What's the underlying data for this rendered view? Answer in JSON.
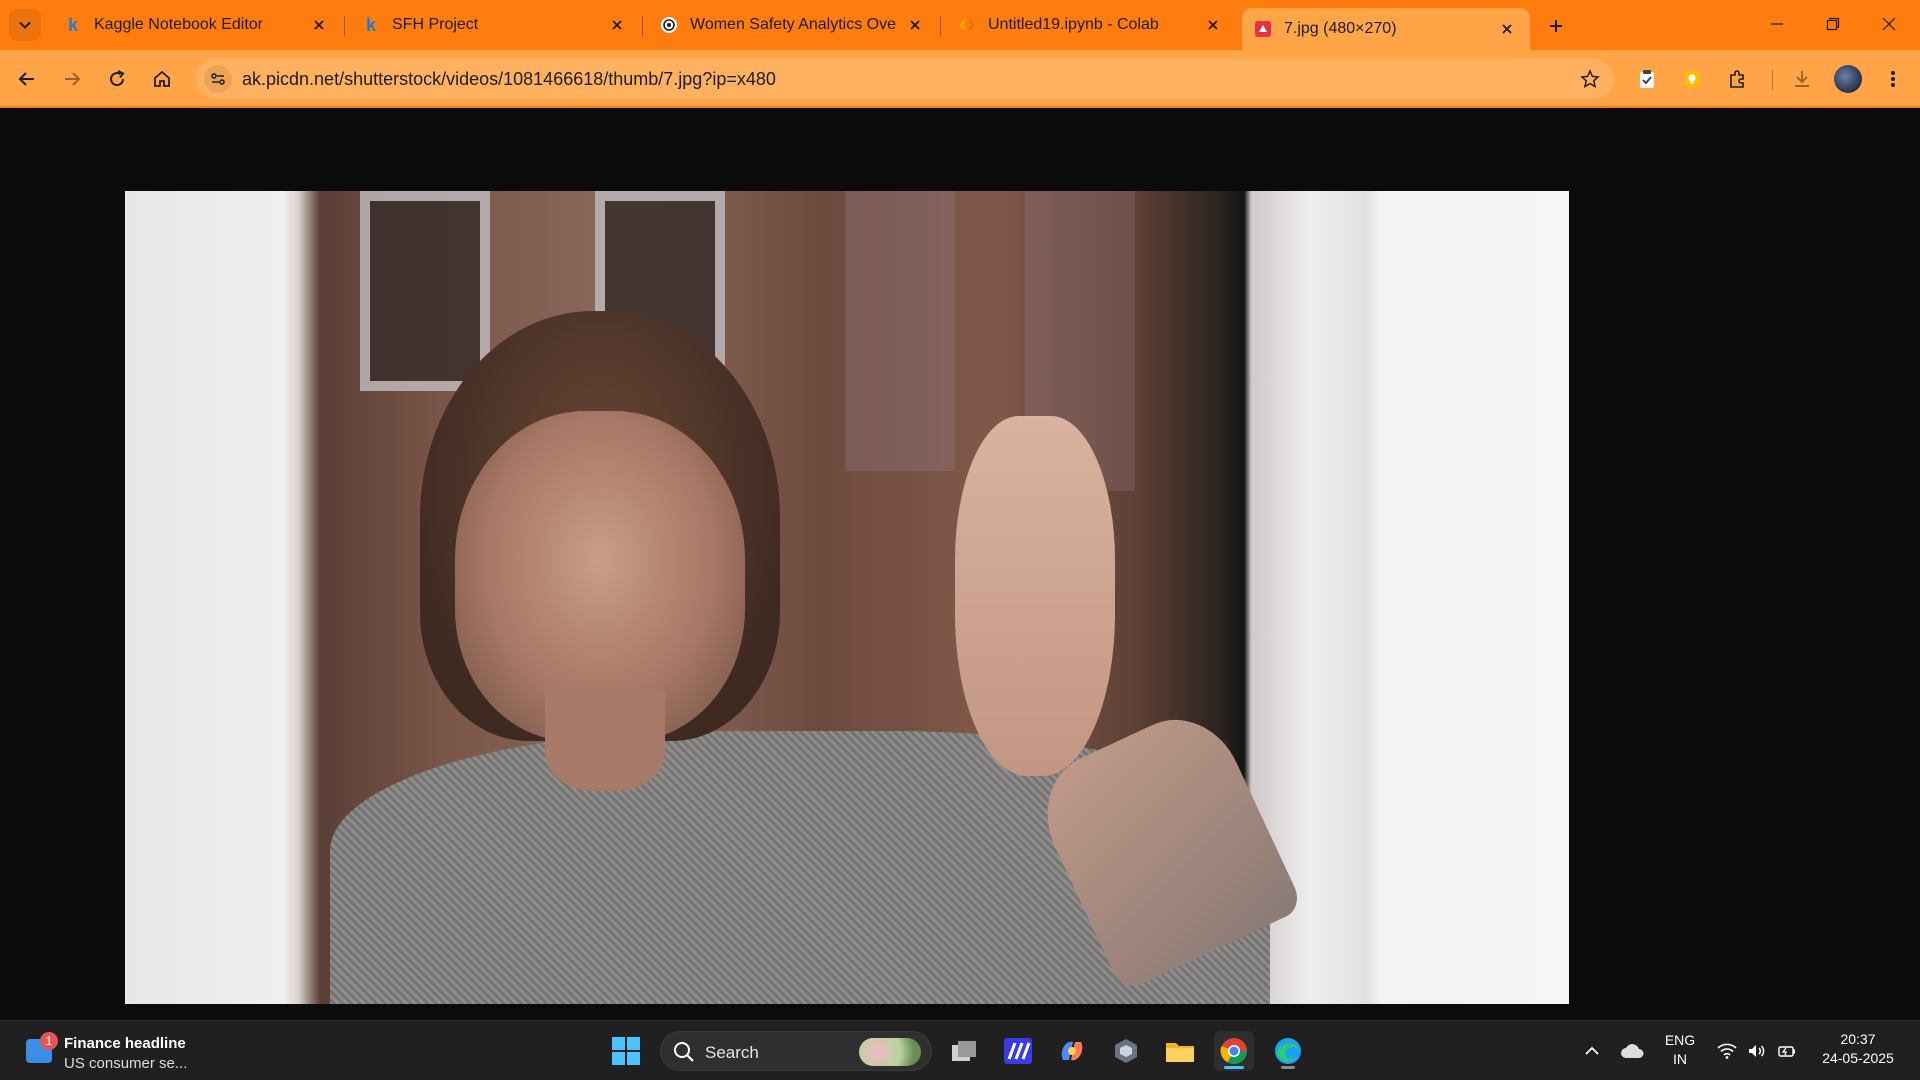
{
  "browser": {
    "tabs": [
      {
        "title": "Kaggle Notebook Editor",
        "favicon": "kaggle-icon",
        "active": false
      },
      {
        "title": "SFH Project",
        "favicon": "kaggle-icon",
        "active": false
      },
      {
        "title": "Women Safety Analytics Overvi",
        "favicon": "chatgpt-icon",
        "active": false
      },
      {
        "title": "Untitled19.ipynb - Colab",
        "favicon": "colab-icon",
        "active": false
      },
      {
        "title": "7.jpg (480×270)",
        "favicon": "picdn-icon",
        "active": true
      }
    ],
    "url": "ak.picdn.net/shutterstock/videos/1081466618/thumb/7.jpg?ip=x480",
    "accent_color": "#ff7c0f",
    "toolbar_color": "#ffa447"
  },
  "image": {
    "description_icon": "photo-woman-at-window"
  },
  "taskbar": {
    "widget": {
      "headline": "Finance headline",
      "subtext": "US consumer se...",
      "badge": "1"
    },
    "search_label": "Search",
    "pinned": [
      "start-icon",
      "task-view-icon",
      "app-icon",
      "copilot-icon",
      "app-icon-2",
      "file-explorer-icon",
      "chrome-icon",
      "edge-icon"
    ],
    "tray": {
      "lang_top": "ENG",
      "lang_bottom": "IN",
      "time": "20:37",
      "date": "24-05-2025"
    }
  }
}
